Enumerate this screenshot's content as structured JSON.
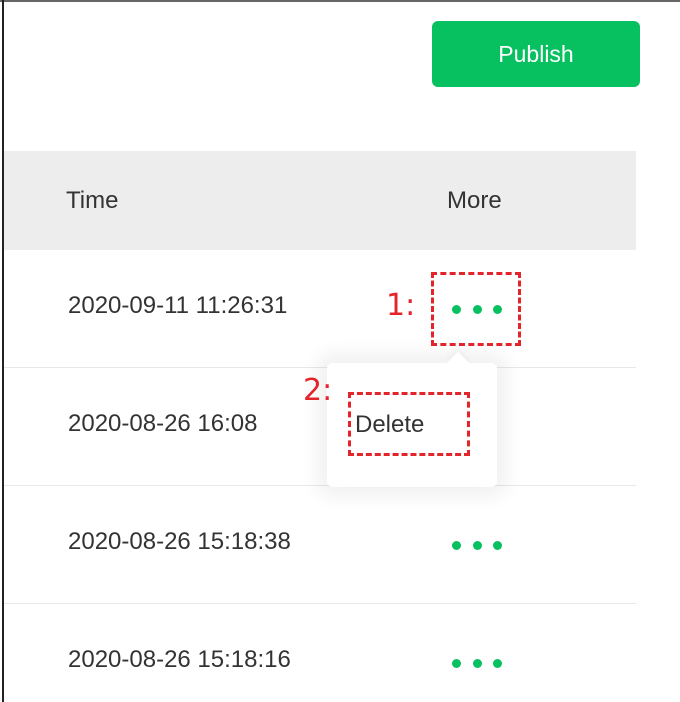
{
  "toolbar": {
    "publish_label": "Publish",
    "accent_color": "#07c160"
  },
  "table": {
    "columns": [
      "Time",
      "More"
    ],
    "rows": [
      {
        "time": "2020-09-11 11:26:31"
      },
      {
        "time": "2020-08-26 16:08"
      },
      {
        "time": "2020-08-26 15:18:38"
      },
      {
        "time": "2020-08-26 15:18:16"
      }
    ]
  },
  "popup": {
    "delete_label": "Delete"
  },
  "annotations": {
    "step1": "1:",
    "step2": "2:",
    "color": "#e3242b"
  },
  "icons": {
    "more": "more-dots-icon"
  }
}
